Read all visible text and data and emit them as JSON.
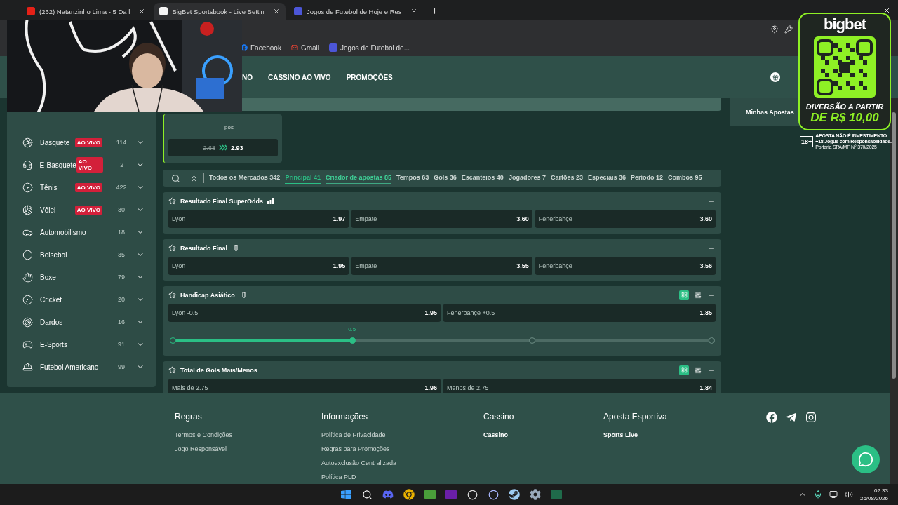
{
  "browser": {
    "tabs": [
      {
        "title": "(262) Natanzinho Lima - 5 Da l",
        "selected": false
      },
      {
        "title": "BigBet Sportsbook - Live Bettin",
        "selected": true
      },
      {
        "title": "Jogos de Futebol de Hoje e Res",
        "selected": false
      }
    ],
    "bookmarks": [
      "Facebook",
      "Gmail",
      "Jogos de Futebol de..."
    ]
  },
  "header": {
    "nav": [
      "NO",
      "CASSINO AO VIVO",
      "PROMOÇÕES"
    ]
  },
  "sidebar": {
    "items": [
      {
        "name": "Basquete",
        "badge": "AO VIVO",
        "count": "114"
      },
      {
        "name": "E-Basquete",
        "badge": "AO VIVO",
        "count": "2"
      },
      {
        "name": "Tênis",
        "badge": "AO VIVO",
        "count": "422"
      },
      {
        "name": "Vôlei",
        "badge": "AO VIVO",
        "count": "30"
      },
      {
        "name": "Automobilismo",
        "count": "18"
      },
      {
        "name": "Beisebol",
        "count": "35"
      },
      {
        "name": "Boxe",
        "count": "79"
      },
      {
        "name": "Cricket",
        "count": "20"
      },
      {
        "name": "Dardos",
        "count": "16"
      },
      {
        "name": "E-Sports",
        "count": "91"
      },
      {
        "name": "Futebol Americano",
        "count": "99"
      }
    ]
  },
  "featured": {
    "label": "pos",
    "old_odds": "2.68",
    "new_odds": "2.93"
  },
  "market_tabs": [
    {
      "label": "Todos os Mercados 342",
      "selected": false,
      "hovered": false
    },
    {
      "label": "Principal 41",
      "selected": true,
      "hovered": false
    },
    {
      "label": "Criador de apostas 85",
      "selected": false,
      "hovered": true
    },
    {
      "label": "Tempos 63",
      "selected": false,
      "hovered": false
    },
    {
      "label": "Gols 36",
      "selected": false,
      "hovered": false
    },
    {
      "label": "Escanteios 40",
      "selected": false,
      "hovered": false
    },
    {
      "label": "Jogadores 7",
      "selected": false,
      "hovered": false
    },
    {
      "label": "Cartões 23",
      "selected": false,
      "hovered": false
    },
    {
      "label": "Especiais 36",
      "selected": false,
      "hovered": false
    },
    {
      "label": "Período 12",
      "selected": false,
      "hovered": false
    },
    {
      "label": "Combos 95",
      "selected": false,
      "hovered": false
    }
  ],
  "markets": [
    {
      "title": "Resultado Final SuperOdds",
      "kind": "superodds",
      "tools": false,
      "selections": [
        {
          "label": "Lyon",
          "odds": "1.97"
        },
        {
          "label": "Empate",
          "odds": "3.60"
        },
        {
          "label": "Fenerbahçe",
          "odds": "3.60"
        }
      ]
    },
    {
      "title": "Resultado Final",
      "kind": "builder",
      "tools": false,
      "selections": [
        {
          "label": "Lyon",
          "odds": "1.95"
        },
        {
          "label": "Empate",
          "odds": "3.55"
        },
        {
          "label": "Fenerbahçe",
          "odds": "3.56"
        }
      ]
    },
    {
      "title": "Handicap Asiático",
      "kind": "builder",
      "tools": true,
      "selections": [
        {
          "label": "Lyon -0.5",
          "odds": "1.95"
        },
        {
          "label": "Fenerbahçe +0.5",
          "odds": "1.85"
        }
      ],
      "slider": {
        "label": "0.5",
        "level": 0.333
      }
    },
    {
      "title": "Total de Gols Mais/Menos",
      "kind": "plain",
      "tools": true,
      "selections": [
        {
          "label": "Mais de 2.75",
          "odds": "1.96"
        },
        {
          "label": "Menos de 2.75",
          "odds": "1.84"
        }
      ]
    }
  ],
  "bet_slip": {
    "title": "Minhas Apostas"
  },
  "footer": {
    "columns": [
      {
        "heading": "Regras",
        "links": [
          "Termos e Condições",
          "Jogo Responsável"
        ],
        "strong": false
      },
      {
        "heading": "Informações",
        "links": [
          "Política de Privacidade",
          "Regras para Promoções",
          "Autoexclusão Centralizada",
          "Política PLD"
        ],
        "strong": false
      },
      {
        "heading": "Cassino",
        "links": [
          "Cassino"
        ],
        "strong": true
      },
      {
        "heading": "Aposta Esportiva",
        "links": [
          "Sports Live"
        ],
        "strong": true
      }
    ]
  },
  "ad": {
    "brand": "bigbet",
    "line1": "DIVERSÃO A PARTIR",
    "line2": "DE R$ 10,00",
    "age": "18+",
    "notes": [
      "APOSTA NÃO É INVESTIMENTO",
      "+18 Jogue com Responsabilidade.",
      "Portaria SPA/MF N° 370/2025"
    ]
  },
  "taskbar": {
    "time": "02:33",
    "date": "26/08/2026"
  }
}
